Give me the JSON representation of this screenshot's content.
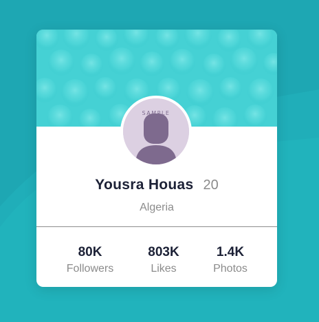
{
  "profile": {
    "name": "Yousra Houas",
    "age": "20",
    "country": "Algeria",
    "avatar_caption": "SAMPLE"
  },
  "stats": [
    {
      "value": "80K",
      "label": "Followers"
    },
    {
      "value": "803K",
      "label": "Likes"
    },
    {
      "value": "1.4K",
      "label": "Photos"
    }
  ],
  "colors": {
    "page_background": "#1ea7b3",
    "banner": "#45d1d4",
    "avatar_background": "#dcd0e2",
    "avatar_silhouette": "#7e6a8e",
    "name_text": "#1c2136",
    "muted_text": "#8b8b8b"
  },
  "icons": {
    "avatar": "person-silhouette-icon"
  }
}
